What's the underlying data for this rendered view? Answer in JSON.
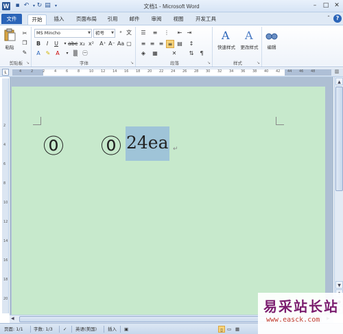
{
  "window": {
    "title": "文档1 - Microsoft Word",
    "app_icon": "W"
  },
  "quick_access": {
    "save": "save-icon",
    "undo": "undo-icon",
    "redo": "redo-icon",
    "print_preview": "print-preview-icon"
  },
  "tabs": [
    {
      "label": "文件",
      "kind": "file"
    },
    {
      "label": "开始",
      "active": true
    },
    {
      "label": "插入"
    },
    {
      "label": "页面布局"
    },
    {
      "label": "引用"
    },
    {
      "label": "邮件"
    },
    {
      "label": "审阅"
    },
    {
      "label": "视图"
    },
    {
      "label": "开发工具"
    }
  ],
  "ribbon": {
    "clipboard": {
      "label": "剪贴板",
      "paste_label": "粘贴"
    },
    "font": {
      "label": "字体",
      "font_name": "MS Mincho",
      "font_size": "初号",
      "wen": "文",
      "a_label": "A"
    },
    "paragraph": {
      "label": "段落"
    },
    "styles": {
      "label": "样式",
      "quick_styles": "快速样式",
      "change_styles": "更改样式"
    },
    "editing": {
      "label": "编辑"
    }
  },
  "ruler": {
    "numbers": [
      "4",
      "2",
      "2",
      "4",
      "6",
      "8",
      "10",
      "12",
      "14",
      "16",
      "18",
      "20",
      "22",
      "24",
      "26",
      "28",
      "30",
      "32",
      "34",
      "36",
      "38",
      "40",
      "42",
      "44",
      "46",
      "48"
    ],
    "vnumbers": [
      "2",
      "4",
      "6",
      "8",
      "10",
      "12",
      "14",
      "16",
      "18",
      "20"
    ]
  },
  "document": {
    "circle_char": "⓪",
    "circle_char_2": "⓪",
    "selected_text": "24ea",
    "para_mark": "↵"
  },
  "statusbar": {
    "page": "页面: 1/1",
    "words": "字数: 1/3",
    "language": "英语(美国)",
    "mode": "插入"
  },
  "watermark": {
    "site_name": "易采站长站",
    "url": "www.easck.com"
  }
}
